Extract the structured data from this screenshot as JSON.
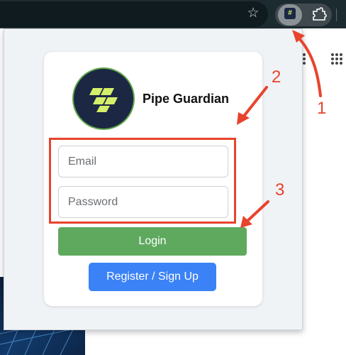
{
  "browser": {
    "bookmark_icon": "star-icon",
    "extension_icon": "pipe-guardian-extension-icon",
    "extensions_menu_icon": "puzzle-icon",
    "apps_icon": "apps-grid-icon"
  },
  "popup": {
    "brand_name": "Pipe Guardian",
    "logo_icon": "pipe-guardian-logo",
    "email_placeholder": "Email",
    "password_placeholder": "Password",
    "login_label": "Login",
    "register_label": "Register / Sign Up"
  },
  "annotations": {
    "step1": "1",
    "step2": "2",
    "step3": "3",
    "color": "#e8432d"
  },
  "colors": {
    "login_button": "#5fa95f",
    "register_button": "#3b82f6",
    "logo_background": "#1c2744",
    "logo_accent": "#d4f06a",
    "logo_ring": "#5fa74a"
  }
}
